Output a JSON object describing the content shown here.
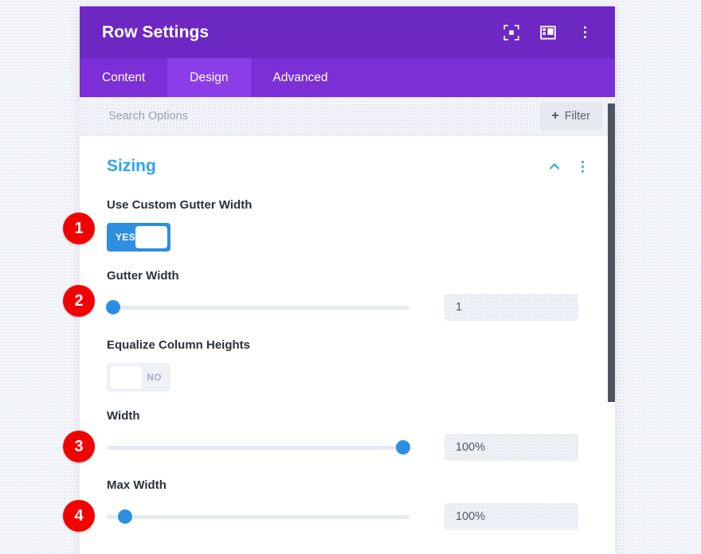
{
  "window": {
    "title": "Row Settings",
    "titlebar_icons": [
      {
        "name": "focus-frame-icon",
        "label": "Focus"
      },
      {
        "name": "layout-split-icon",
        "label": "Layout"
      },
      {
        "name": "more-vertical-icon",
        "label": "More options"
      }
    ]
  },
  "tabs": [
    {
      "label": "Content",
      "active": false
    },
    {
      "label": "Design",
      "active": true
    },
    {
      "label": "Advanced",
      "active": false
    }
  ],
  "search": {
    "placeholder": "Search Options",
    "value": "",
    "filter_label": "Filter",
    "filter_plus": "+"
  },
  "section": {
    "title": "Sizing",
    "collapse_state": "expanded"
  },
  "fields": [
    {
      "label": "Use Custom Gutter Width",
      "type": "toggle",
      "state": "on",
      "state_label": "YES"
    },
    {
      "label": "Gutter Width",
      "type": "slider",
      "value": "1",
      "percent": 2
    },
    {
      "label": "Equalize Column Heights",
      "type": "toggle",
      "state": "off",
      "state_label": "NO"
    },
    {
      "label": "Width",
      "type": "slider",
      "value": "100%",
      "percent": 98
    },
    {
      "label": "Max Width",
      "type": "slider",
      "value": "100%",
      "percent": 6
    }
  ],
  "badges": [
    {
      "number": "1"
    },
    {
      "number": "2"
    },
    {
      "number": "3"
    },
    {
      "number": "4"
    }
  ],
  "colors": {
    "titlebar": "#6d28c4",
    "tabbar": "#7b2fd6",
    "tab_active": "#8b3ee8",
    "accent_blue": "#2ea3f2",
    "slider_blue": "#2e8fe0",
    "badge_red": "#f50000",
    "scrollbar": "#4b5563"
  }
}
